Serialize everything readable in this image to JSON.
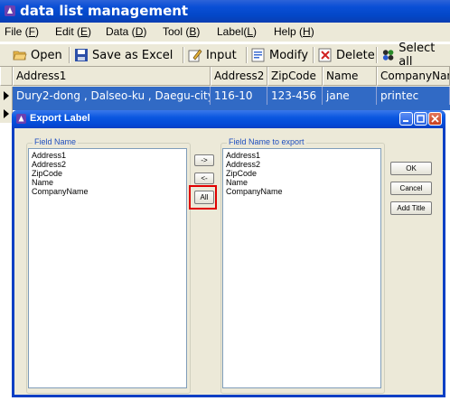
{
  "window": {
    "title": "data list management"
  },
  "menu": [
    {
      "label": "File (",
      "key": "F",
      "suffix": ")"
    },
    {
      "label": "Edit (",
      "key": "E",
      "suffix": ")"
    },
    {
      "label": "Data (",
      "key": "D",
      "suffix": ")"
    },
    {
      "label": "Tool (",
      "key": "B",
      "suffix": ")"
    },
    {
      "label": "Label(",
      "key": "L",
      "suffix": ")"
    },
    {
      "label": "Help (",
      "key": "H",
      "suffix": ")"
    }
  ],
  "toolbar": {
    "open": "Open",
    "save_excel": "Save as Excel",
    "input": "Input",
    "modify": "Modify",
    "delete": "Delete",
    "select_all": "Select all"
  },
  "grid": {
    "columns": [
      "Address1",
      "Address2",
      "ZipCode",
      "Name",
      "CompanyName"
    ],
    "rows": [
      [
        "Dury2-dong , Dalseo-ku , Daegu-city",
        "116-10",
        "123-456",
        "jane",
        "printec"
      ]
    ]
  },
  "dialog": {
    "title": "Export Label",
    "left_group_label": "Field Name",
    "right_group_label": "Field Name to export",
    "left_items": [
      "Address1",
      "Address2",
      "ZipCode",
      "Name",
      "CompanyName"
    ],
    "right_items": [
      "Address1",
      "Address2",
      "ZipCode",
      "Name",
      "CompanyName"
    ],
    "move_right": "->",
    "move_left": "<-",
    "move_all": "All",
    "ok": "OK",
    "cancel": "Cancel",
    "add_title": "Add Title"
  },
  "colors": {
    "titlebar": "#0a4fd6",
    "selection": "#316ac5",
    "highlight": "#e00000"
  },
  "icons": [
    "app-icon",
    "open-folder-icon",
    "save-disk-icon",
    "input-pencil-icon",
    "modify-icon",
    "delete-icon",
    "select-all-icon",
    "row-pointer-icon"
  ]
}
